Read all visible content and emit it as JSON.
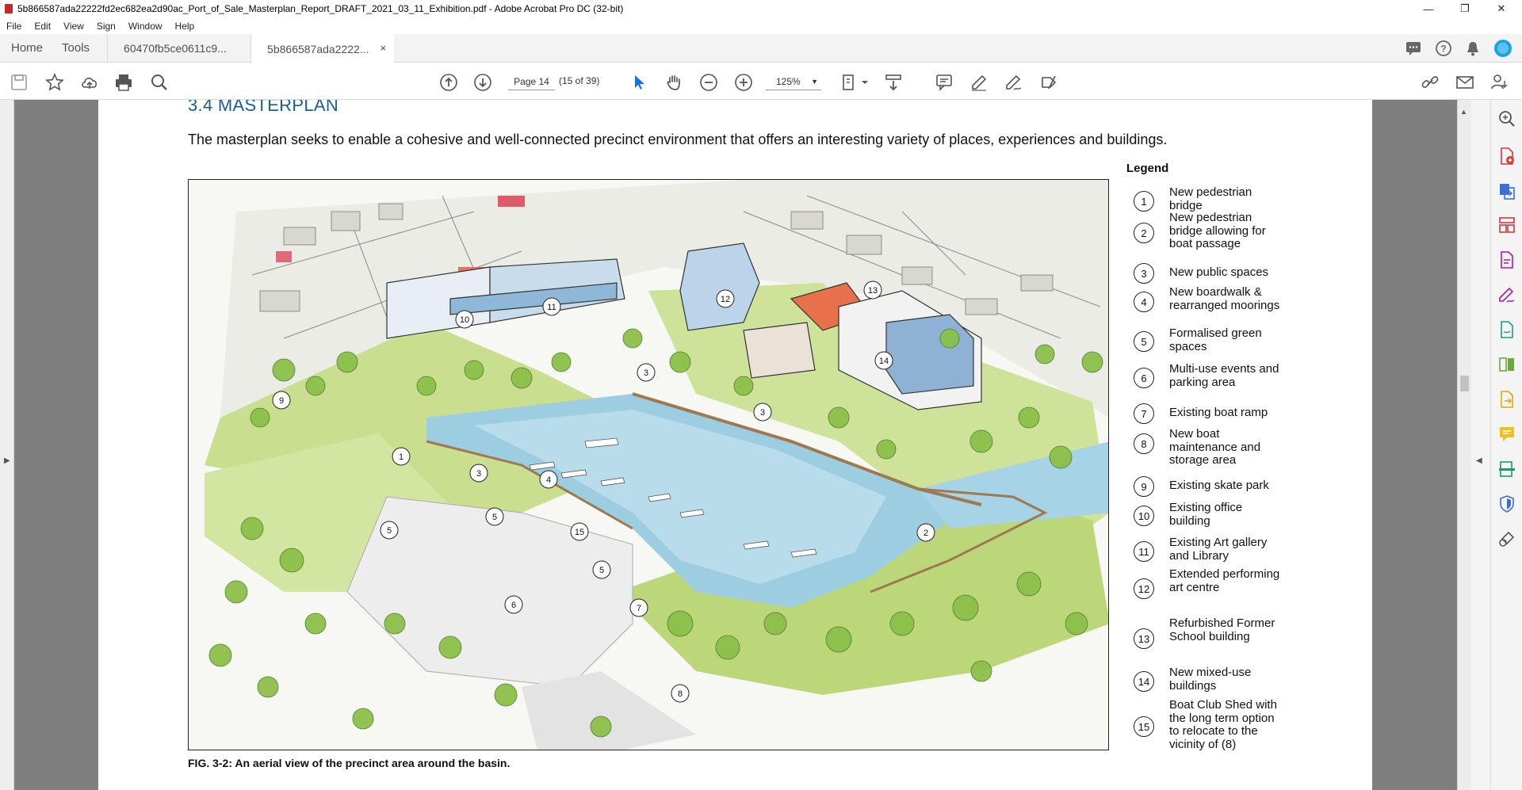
{
  "window": {
    "title": "5b866587ada22222fd2ec682ea2d90ac_Port_of_Sale_Masterplan_Report_DRAFT_2021_03_11_Exhibition.pdf - Adobe Acrobat Pro DC (32-bit)",
    "minimize": "—",
    "maximize": "❐",
    "close": "✕"
  },
  "menu": [
    "File",
    "Edit",
    "View",
    "Sign",
    "Window",
    "Help"
  ],
  "tabs": {
    "home": "Home",
    "tools": "Tools",
    "doc1": "60470fb5ce0611c9...",
    "doc2": "5b866587ada2222...",
    "close": "×"
  },
  "toolbar": {
    "page_label": "Page 14",
    "page_of": "(15 of 39)",
    "zoom": "125%"
  },
  "document": {
    "heading": "3.4 MASTERPLAN",
    "intro": "The masterplan seeks to enable a cohesive and well-connected precinct environment that offers an interesting variety of places, experiences and buildings.",
    "caption": "FIG. 3-2: An aerial view of the precinct area around the basin.",
    "legend_title": "Legend",
    "legend": [
      {
        "num": "1",
        "text": "New pedestrian bridge"
      },
      {
        "num": "2",
        "text": "New pedestrian bridge allowing for boat passage"
      },
      {
        "num": "3",
        "text": "New public spaces"
      },
      {
        "num": "4",
        "text": "New boardwalk & rearranged moorings"
      },
      {
        "num": "5",
        "text": "Formalised green spaces"
      },
      {
        "num": "6",
        "text": "Multi-use events and parking area"
      },
      {
        "num": "7",
        "text": "Existing boat ramp"
      },
      {
        "num": "8",
        "text": "New boat maintenance and storage area"
      },
      {
        "num": "9",
        "text": "Existing skate park"
      },
      {
        "num": "10",
        "text": "Existing office building"
      },
      {
        "num": "11",
        "text": "Existing Art gallery and Library"
      },
      {
        "num": "12",
        "text": "Extended performing art centre"
      },
      {
        "num": "13",
        "text": "Refurbished Former School building"
      },
      {
        "num": "14",
        "text": "New mixed-use buildings"
      },
      {
        "num": "15",
        "text": "Boat Club Shed with the long term option to relocate to the vicinity of (8)"
      }
    ],
    "map_markers": [
      "1",
      "2",
      "3",
      "3",
      "3",
      "4",
      "5",
      "5",
      "5",
      "6",
      "7",
      "8",
      "9",
      "10",
      "11",
      "12",
      "13",
      "14",
      "15"
    ]
  },
  "colors": {
    "heading": "#1b5e8c",
    "viewer_bg": "#7f7f7f",
    "accent_blue": "#1473e6",
    "tool_purple": "#b5179e"
  }
}
